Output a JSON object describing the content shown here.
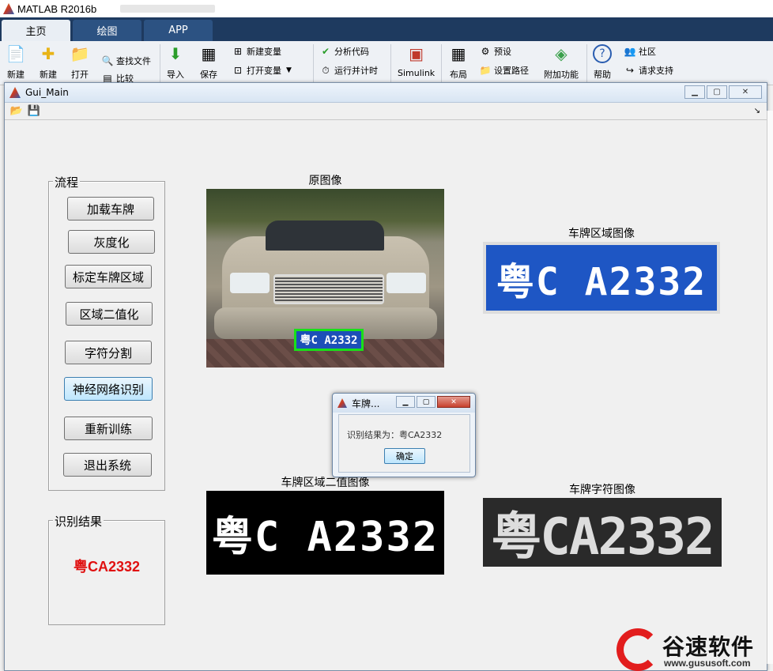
{
  "app": {
    "title": "MATLAB R2016b"
  },
  "ribbon": {
    "tabs": [
      "主页",
      "绘图",
      "APP"
    ],
    "buttons": {
      "new_script": "新建",
      "new": "新建",
      "open": "打开",
      "find_files": "查找文件",
      "compare": "比较",
      "import": "导入",
      "save": "保存",
      "new_variable": "新建变量",
      "open_variable": "打开变量",
      "analyze_code": "分析代码",
      "run_time": "运行并计时",
      "simulink": "Simulink",
      "layout": "布局",
      "preferences": "预设",
      "set_path": "设置路径",
      "addons": "附加功能",
      "help": "帮助",
      "community": "社区",
      "support": "请求支持"
    }
  },
  "gui": {
    "title": "Gui_Main",
    "flow_panel": {
      "title": "流程",
      "buttons": [
        "加载车牌",
        "灰度化",
        "标定车牌区域",
        "区域二值化",
        "字符分割",
        "神经网络识别",
        "重新训练",
        "退出系统"
      ]
    },
    "result_panel": {
      "title": "识别结果",
      "value": "粤CA2332"
    },
    "captions": {
      "original": "原图像",
      "plate_region": "车牌区域图像",
      "binary": "车牌区域二值图像",
      "chars": "车牌字符图像"
    },
    "plate_text": "粤C A2332",
    "plate_text_compact": "粤CA2332"
  },
  "dialog": {
    "title": "车牌...",
    "message": "识别结果为：粤CA2332",
    "ok_label": "确定"
  },
  "watermark": {
    "name": "谷速软件",
    "url": "www.gususoft.com"
  },
  "colors": {
    "ribbon_tab_bg": "#1e3a5f",
    "result_red": "#e01010",
    "plate_blue": "#1e56c4",
    "detect_green": "#19e019"
  }
}
